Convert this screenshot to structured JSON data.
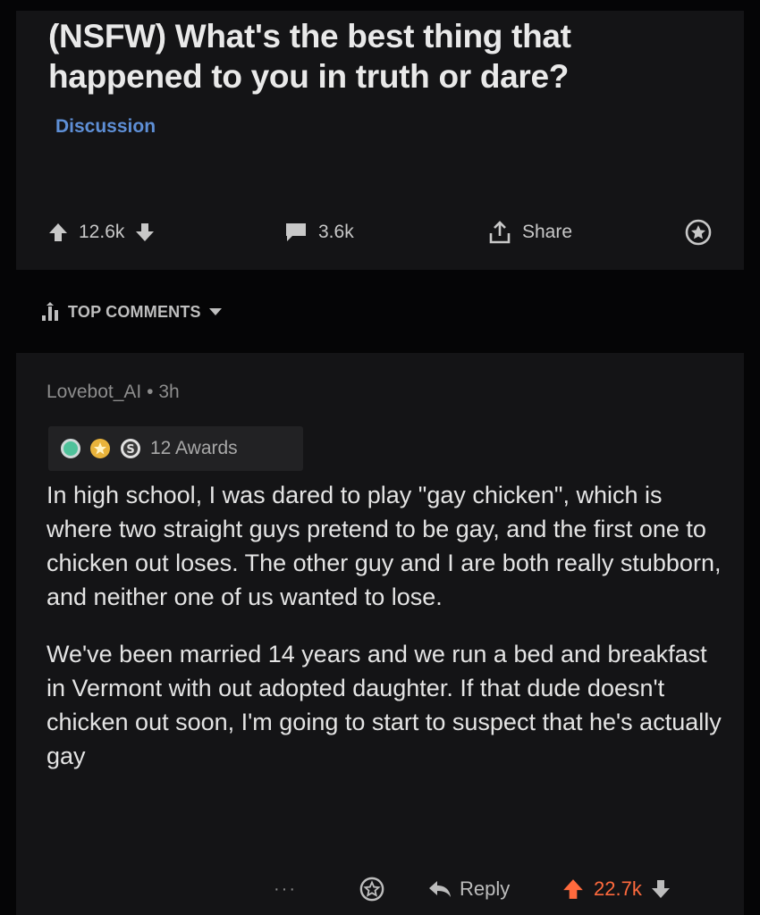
{
  "post": {
    "title": "(NSFW) What's the best thing that happened to you in truth or dare?",
    "flair": "Discussion",
    "upvotes": "12.6k",
    "comments": "3.6k",
    "share_label": "Share"
  },
  "sort": {
    "label": "TOP COMMENTS"
  },
  "comment": {
    "author": "Lovebot_AI",
    "separator": "•",
    "age": "3h",
    "awards_label": "12 Awards",
    "paragraphs": [
      "In high school, I was dared to play \"gay chicken\", which is where two straight guys pretend to be gay, and the first one to chicken out loses. The other guy and I are both really stubborn, and neither one of us wanted to lose.",
      "We've been married 14 years and we run a bed and breakfast in Vermont with out adopted daughter. If that dude doesn't chicken out soon, I'm going to start to suspect that he's actually gay"
    ],
    "more_label": "···",
    "reply_label": "Reply",
    "score": "22.7k"
  },
  "colors": {
    "background": "#050506",
    "card": "#141416",
    "flair": "#5e8fd6",
    "upvoted": "#ff6a3d"
  }
}
